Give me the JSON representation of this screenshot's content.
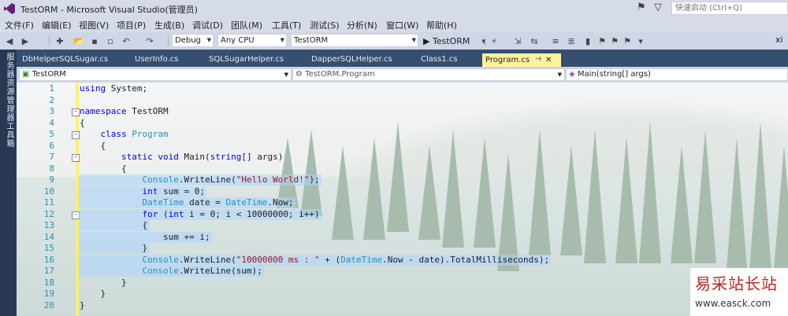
{
  "window": {
    "title": "TestORM - Microsoft Visual Studio(管理员)",
    "quick_launch_placeholder": "快速启动 (Ctrl+Q)",
    "user_initial": "xi"
  },
  "menu": [
    "文件(F)",
    "编辑(E)",
    "视图(V)",
    "项目(P)",
    "生成(B)",
    "调试(D)",
    "团队(M)",
    "工具(T)",
    "测试(S)",
    "分析(N)",
    "窗口(W)",
    "帮助(H)"
  ],
  "toolbar": {
    "configuration": "Debug",
    "platform": "Any CPU",
    "startup_project": "TestORM",
    "start_label": "▶ TestORM"
  },
  "side_panels": [
    "服务器资源管理器",
    "工具箱"
  ],
  "tabs": [
    {
      "label": "DbHelperSQLSugar.cs",
      "active": false
    },
    {
      "label": "UserInfo.cs",
      "active": false
    },
    {
      "label": "SQLSugarHelper.cs",
      "active": false
    },
    {
      "label": "DapperSQLHelper.cs",
      "active": false
    },
    {
      "label": "Class1.cs",
      "active": false
    },
    {
      "label": "Program.cs",
      "active": true
    }
  ],
  "nav": {
    "project": "TestORM",
    "type": "TestORM.Program",
    "member": "Main(string[] args)"
  },
  "code": {
    "lines": [
      {
        "n": "1",
        "text": "using System;"
      },
      {
        "n": "2",
        "text": ""
      },
      {
        "n": "3",
        "text": "namespace TestORM"
      },
      {
        "n": "4",
        "text": "{"
      },
      {
        "n": "5",
        "text": "    class Program"
      },
      {
        "n": "6",
        "text": "    {"
      },
      {
        "n": "7",
        "text": "        static void Main(string[] args)"
      },
      {
        "n": "8",
        "text": "        {"
      },
      {
        "n": "9",
        "text": "            Console.WriteLine(\"Hello World!\");"
      },
      {
        "n": "10",
        "text": "            int sum = 0;"
      },
      {
        "n": "11",
        "text": "            DateTime date = DateTime.Now;"
      },
      {
        "n": "12",
        "text": "            for (int i = 0; i < 10000000; i++)"
      },
      {
        "n": "13",
        "text": "            {"
      },
      {
        "n": "14",
        "text": "                sum += i;"
      },
      {
        "n": "15",
        "text": "            }"
      },
      {
        "n": "16",
        "text": "            Console.WriteLine(\"10000000 ms : \" + (DateTime.Now - date).TotalMilliseconds);"
      },
      {
        "n": "17",
        "text": "            Console.WriteLine(sum);"
      },
      {
        "n": "18",
        "text": "        }"
      },
      {
        "n": "19",
        "text": "    }"
      },
      {
        "n": "20",
        "text": "}"
      }
    ]
  },
  "watermark": {
    "title": "易采站长站",
    "url": "www.easck.com"
  },
  "colors": {
    "keyword": "#0000ff",
    "type": "#2b91af",
    "string": "#a31515",
    "tab_active": "#fff29d",
    "tabstrip": "#364e6f"
  }
}
